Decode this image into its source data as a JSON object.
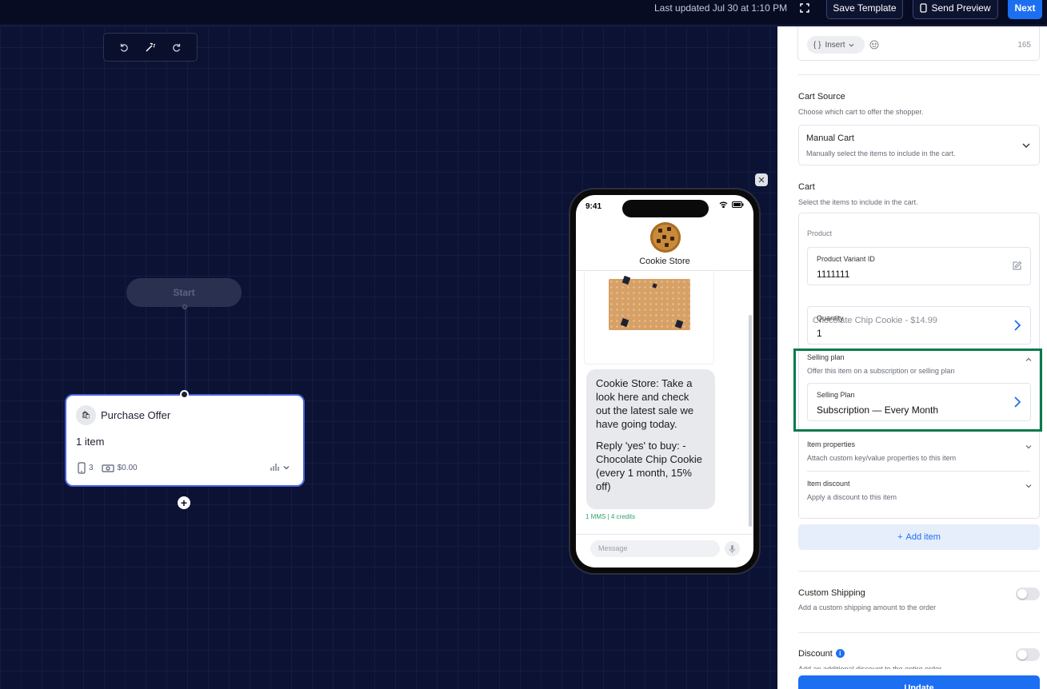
{
  "header": {
    "last_updated": "Last updated Jul 30 at 1:10 PM",
    "save_template": "Save Template",
    "send_preview": "Send Preview",
    "next": "Next"
  },
  "canvas": {
    "toolbar_icons": [
      "undo-icon",
      "magic-wand-icon",
      "redo-icon"
    ],
    "start_node": "Start",
    "node": {
      "title": "Purchase Offer",
      "items": "1 item",
      "message_count": "3",
      "amount": "$0.00"
    }
  },
  "phone": {
    "time": "9:41",
    "store_name": "Cookie Store",
    "message_p1": "Cookie Store: Take a look here and check out the latest sale we have going today.",
    "message_p2": "Reply 'yes' to buy: - Chocolate Chip Cookie (every 1 month, 15% off)",
    "credits": "1 MMS | 4 credits",
    "input_placeholder": "Message"
  },
  "panel": {
    "insert_label": "Insert",
    "char_count": "165",
    "cart_source": {
      "title": "Cart Source",
      "subtitle": "Choose which cart to offer the shopper.",
      "selected": "Manual Cart",
      "selected_desc": "Manually select the items to include in the cart."
    },
    "cart": {
      "title": "Cart",
      "subtitle": "Select the items to include in the cart.",
      "product_label": "Product",
      "variant_label": "Product Variant ID",
      "variant_value": "1111111",
      "product_desc": "Chocolate Chip Cookie - $14.99",
      "quantity_label": "Quantity",
      "quantity_value": "1",
      "selling_plan_title": "Selling plan",
      "selling_plan_sub": "Offer this item on a subscription or selling plan",
      "selling_plan_label": "Selling Plan",
      "selling_plan_value": "Subscription — Every Month",
      "item_props_title": "Item properties",
      "item_props_sub": "Attach custom key/value properties to this item",
      "item_discount_title": "Item discount",
      "item_discount_sub": "Apply a discount to this item"
    },
    "add_item": "Add item",
    "custom_shipping": {
      "title": "Custom Shipping",
      "subtitle": "Add a custom shipping amount to the order",
      "enabled": false
    },
    "discount": {
      "title": "Discount",
      "subtitle": "Add an additional discount to the entire order",
      "enabled": false
    },
    "update": "Update"
  },
  "colors": {
    "accent": "#1d6ff2",
    "canvas_bg": "#0b1233",
    "highlight": "#0a7a4c",
    "credits": "#2ea36d"
  }
}
